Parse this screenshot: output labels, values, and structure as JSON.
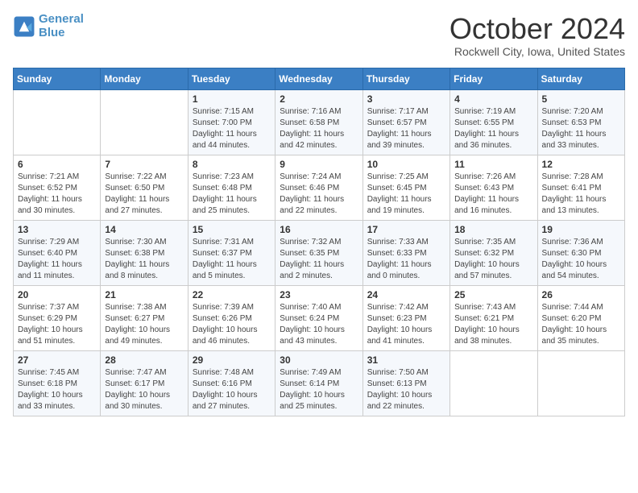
{
  "header": {
    "logo_line1": "General",
    "logo_line2": "Blue",
    "month": "October 2024",
    "location": "Rockwell City, Iowa, United States"
  },
  "days_of_week": [
    "Sunday",
    "Monday",
    "Tuesday",
    "Wednesday",
    "Thursday",
    "Friday",
    "Saturday"
  ],
  "weeks": [
    [
      {
        "day": "",
        "info": ""
      },
      {
        "day": "",
        "info": ""
      },
      {
        "day": "1",
        "info": "Sunrise: 7:15 AM\nSunset: 7:00 PM\nDaylight: 11 hours and 44 minutes."
      },
      {
        "day": "2",
        "info": "Sunrise: 7:16 AM\nSunset: 6:58 PM\nDaylight: 11 hours and 42 minutes."
      },
      {
        "day": "3",
        "info": "Sunrise: 7:17 AM\nSunset: 6:57 PM\nDaylight: 11 hours and 39 minutes."
      },
      {
        "day": "4",
        "info": "Sunrise: 7:19 AM\nSunset: 6:55 PM\nDaylight: 11 hours and 36 minutes."
      },
      {
        "day": "5",
        "info": "Sunrise: 7:20 AM\nSunset: 6:53 PM\nDaylight: 11 hours and 33 minutes."
      }
    ],
    [
      {
        "day": "6",
        "info": "Sunrise: 7:21 AM\nSunset: 6:52 PM\nDaylight: 11 hours and 30 minutes."
      },
      {
        "day": "7",
        "info": "Sunrise: 7:22 AM\nSunset: 6:50 PM\nDaylight: 11 hours and 27 minutes."
      },
      {
        "day": "8",
        "info": "Sunrise: 7:23 AM\nSunset: 6:48 PM\nDaylight: 11 hours and 25 minutes."
      },
      {
        "day": "9",
        "info": "Sunrise: 7:24 AM\nSunset: 6:46 PM\nDaylight: 11 hours and 22 minutes."
      },
      {
        "day": "10",
        "info": "Sunrise: 7:25 AM\nSunset: 6:45 PM\nDaylight: 11 hours and 19 minutes."
      },
      {
        "day": "11",
        "info": "Sunrise: 7:26 AM\nSunset: 6:43 PM\nDaylight: 11 hours and 16 minutes."
      },
      {
        "day": "12",
        "info": "Sunrise: 7:28 AM\nSunset: 6:41 PM\nDaylight: 11 hours and 13 minutes."
      }
    ],
    [
      {
        "day": "13",
        "info": "Sunrise: 7:29 AM\nSunset: 6:40 PM\nDaylight: 11 hours and 11 minutes."
      },
      {
        "day": "14",
        "info": "Sunrise: 7:30 AM\nSunset: 6:38 PM\nDaylight: 11 hours and 8 minutes."
      },
      {
        "day": "15",
        "info": "Sunrise: 7:31 AM\nSunset: 6:37 PM\nDaylight: 11 hours and 5 minutes."
      },
      {
        "day": "16",
        "info": "Sunrise: 7:32 AM\nSunset: 6:35 PM\nDaylight: 11 hours and 2 minutes."
      },
      {
        "day": "17",
        "info": "Sunrise: 7:33 AM\nSunset: 6:33 PM\nDaylight: 11 hours and 0 minutes."
      },
      {
        "day": "18",
        "info": "Sunrise: 7:35 AM\nSunset: 6:32 PM\nDaylight: 10 hours and 57 minutes."
      },
      {
        "day": "19",
        "info": "Sunrise: 7:36 AM\nSunset: 6:30 PM\nDaylight: 10 hours and 54 minutes."
      }
    ],
    [
      {
        "day": "20",
        "info": "Sunrise: 7:37 AM\nSunset: 6:29 PM\nDaylight: 10 hours and 51 minutes."
      },
      {
        "day": "21",
        "info": "Sunrise: 7:38 AM\nSunset: 6:27 PM\nDaylight: 10 hours and 49 minutes."
      },
      {
        "day": "22",
        "info": "Sunrise: 7:39 AM\nSunset: 6:26 PM\nDaylight: 10 hours and 46 minutes."
      },
      {
        "day": "23",
        "info": "Sunrise: 7:40 AM\nSunset: 6:24 PM\nDaylight: 10 hours and 43 minutes."
      },
      {
        "day": "24",
        "info": "Sunrise: 7:42 AM\nSunset: 6:23 PM\nDaylight: 10 hours and 41 minutes."
      },
      {
        "day": "25",
        "info": "Sunrise: 7:43 AM\nSunset: 6:21 PM\nDaylight: 10 hours and 38 minutes."
      },
      {
        "day": "26",
        "info": "Sunrise: 7:44 AM\nSunset: 6:20 PM\nDaylight: 10 hours and 35 minutes."
      }
    ],
    [
      {
        "day": "27",
        "info": "Sunrise: 7:45 AM\nSunset: 6:18 PM\nDaylight: 10 hours and 33 minutes."
      },
      {
        "day": "28",
        "info": "Sunrise: 7:47 AM\nSunset: 6:17 PM\nDaylight: 10 hours and 30 minutes."
      },
      {
        "day": "29",
        "info": "Sunrise: 7:48 AM\nSunset: 6:16 PM\nDaylight: 10 hours and 27 minutes."
      },
      {
        "day": "30",
        "info": "Sunrise: 7:49 AM\nSunset: 6:14 PM\nDaylight: 10 hours and 25 minutes."
      },
      {
        "day": "31",
        "info": "Sunrise: 7:50 AM\nSunset: 6:13 PM\nDaylight: 10 hours and 22 minutes."
      },
      {
        "day": "",
        "info": ""
      },
      {
        "day": "",
        "info": ""
      }
    ]
  ]
}
